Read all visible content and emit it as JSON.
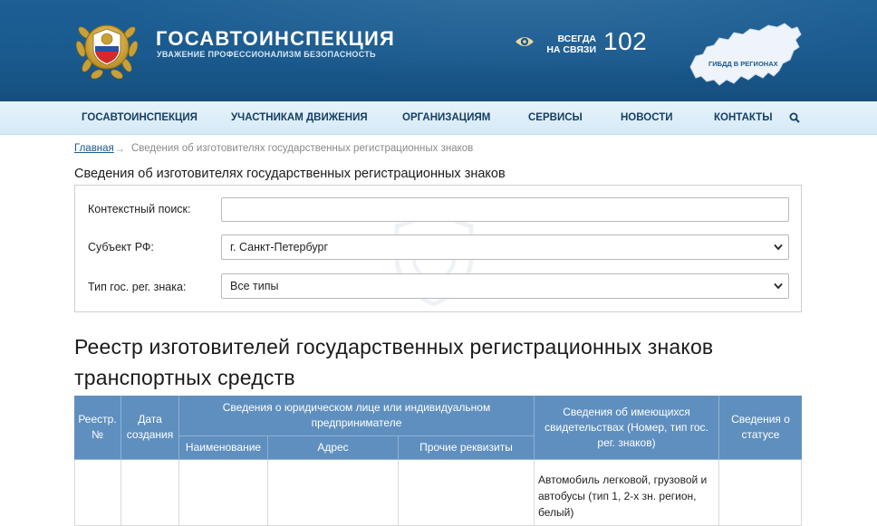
{
  "header": {
    "title": "ГОСАВТОИНСПЕКЦИЯ",
    "subtitle": "УВАЖЕНИЕ ПРОФЕССИОНАЛИЗМ БЕЗОПАСНОСТЬ",
    "always_line1": "ВСЕГДА",
    "always_line2": "НА СВЯЗИ",
    "phone": "102",
    "map_label": "ГИБДД В РЕГИОНАХ",
    "colors": {
      "primary": "#1a5a8e",
      "nav_bg": "#d9edf8",
      "table_head": "#5f8fbf"
    }
  },
  "nav": {
    "items": [
      {
        "label": "ГОСАВТОИНСПЕКЦИЯ"
      },
      {
        "label": "УЧАСТНИКАМ ДВИЖЕНИЯ"
      },
      {
        "label": "ОРГАНИЗАЦИЯМ"
      },
      {
        "label": "СЕРВИСЫ"
      },
      {
        "label": "НОВОСТИ"
      },
      {
        "label": "КОНТАКТЫ"
      }
    ],
    "search_icon": "search-icon"
  },
  "breadcrumb": {
    "home": "Главная",
    "arrow": "→",
    "current": "Сведения об изготовителях государственных регистрационных знаков"
  },
  "filters": {
    "title": "Сведения об изготовителях государственных регистрационных знаков",
    "search_label": "Контекстный поиск:",
    "search_value": "",
    "region_label": "Субъект РФ:",
    "region_value": "г. Санкт-Петербург",
    "type_label": "Тип гос. рег. знака:",
    "type_value": "Все типы"
  },
  "registry": {
    "title_line1": "Реестр изготовителей государственных регистрационных знаков",
    "title_line2": "транспортных средств",
    "headers": {
      "reg_no": "Реестр. №",
      "date": "Дата создания",
      "entity": "Сведения о юридическом лице или индивидуальном предпринимателе",
      "name": "Наименование",
      "address": "Адрес",
      "other": "Прочие реквизиты",
      "certificates": "Сведения об имеющихся свидетельствах (Номер, тип гос. рег. знаков)",
      "status": "Сведения о статусе"
    },
    "rows": [
      {
        "certificates": "Автомобиль легковой, грузовой и автобусы (тип 1, 2-х зн. регион, белый)"
      }
    ]
  }
}
